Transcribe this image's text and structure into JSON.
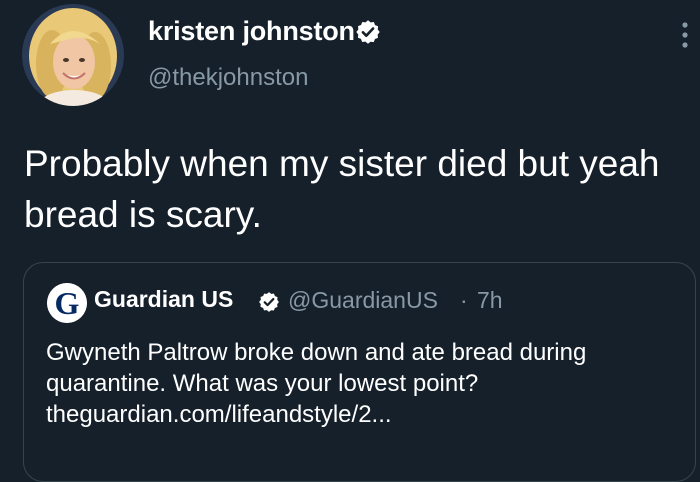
{
  "tweet": {
    "author": {
      "name": "kristen johnston",
      "handle": "@thekjohnston",
      "verified": true,
      "avatar_icon": "profile-photo"
    },
    "text": "Probably when my sister died but yeah bread is scary.",
    "menu_icon": "more-vertical-icon"
  },
  "quoted_tweet": {
    "author": {
      "name": "Guardian US",
      "handle": "@GuardianUS",
      "verified": true,
      "avatar_icon": "guardian-logo",
      "avatar_letter": "G"
    },
    "separator": "·",
    "time": "7h",
    "text_line_1": "Gwyneth Paltrow broke down and ate bread during",
    "text_line_2": "quarantine. What was your lowest point?",
    "link": "theguardian.com/lifeandstyle/2..."
  },
  "colors": {
    "background": "#15202b",
    "primary_text": "#ffffff",
    "secondary_text": "#8899a6",
    "border": "#38444d",
    "guardian_blue": "#052962"
  }
}
